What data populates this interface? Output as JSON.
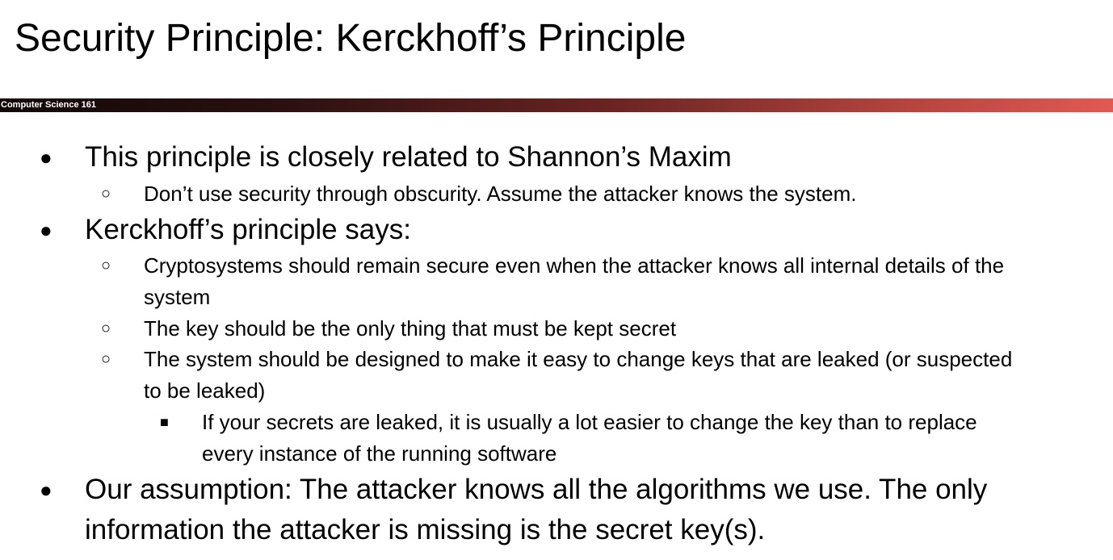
{
  "slide": {
    "title": "Security Principle: Kerckhoff’s Principle",
    "course_label": "Computer Science 161"
  },
  "bullets": {
    "l1_symbol": "●",
    "l2_symbol": "○",
    "l3_symbol": "■"
  },
  "content": {
    "p1": "This principle is closely related to Shannon’s Maxim",
    "p1_s1": "Don’t use security through obscurity. Assume the attacker knows the system.",
    "p2": "Kerckhoff’s principle says:",
    "p2_s1_line1": "Cryptosystems should remain secure even when the attacker knows all internal details of the",
    "p2_s1_line2": "system",
    "p2_s2": "The key should be the only thing that must be kept secret",
    "p2_s3_line1": "The system should be designed to make it easy to change keys that are leaked (or suspected",
    "p2_s3_line2": "to be leaked)",
    "p2_s3_s1_line1": "If your secrets are leaked, it is usually a lot easier to change the key than to replace",
    "p2_s3_s1_line2": "every instance of the running software",
    "p3_line1": "Our assumption: The attacker knows all the algorithms we use. The only",
    "p3_line2": "information the attacker is missing is the secret key(s)."
  }
}
